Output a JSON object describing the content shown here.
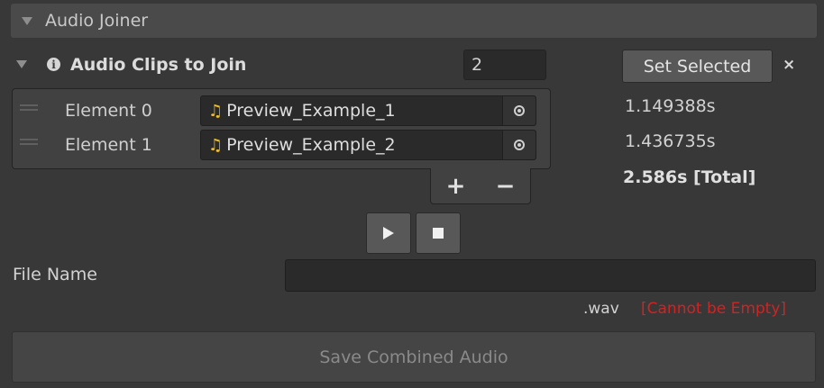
{
  "header": {
    "title": "Audio Joiner"
  },
  "clips": {
    "title": "Audio Clips to Join",
    "count": "2",
    "set_selected_label": "Set Selected",
    "clear_label": "×",
    "elements": [
      {
        "label": "Element 0",
        "clip": "Preview_Example_1",
        "duration": "1.149388s"
      },
      {
        "label": "Element 1",
        "clip": "Preview_Example_2",
        "duration": "1.436735s"
      }
    ],
    "total": "2.586s [Total]",
    "add_label": "+",
    "remove_label": "−"
  },
  "file": {
    "label": "File Name",
    "value": "",
    "extension": ".wav",
    "error": "[Cannot be Empty]"
  },
  "save_label": "Save Combined Audio",
  "colors": {
    "background": "#383838",
    "header": "#4a4a4a",
    "error": "#d32222",
    "audio_icon": "#f0c020"
  }
}
